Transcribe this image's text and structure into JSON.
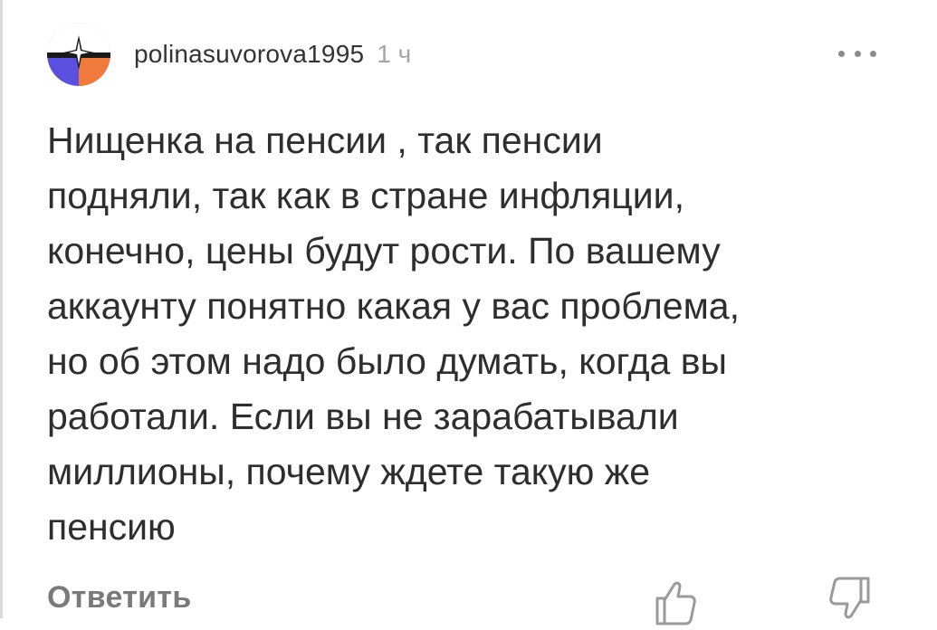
{
  "comment": {
    "username": "polinasuvorova1995",
    "time": "1 ч",
    "more_icon": "more-horizontal-icon",
    "lines": [
      "Нищенка на пенсии , так пенсии",
      "подняли, так как в стране инфляции,",
      "конечно, цены будут рости. По вашему",
      "аккаунту понятно какая у вас проблема,",
      "но об этом надо было думать, когда вы",
      "работали. Если вы не зарабатывали",
      "миллионы, почему ждете такую же",
      "пенсию"
    ]
  },
  "actions": {
    "reply_label": "Ответить",
    "like_icon": "thumbs-up-icon",
    "dislike_icon": "thumbs-down-icon"
  },
  "colors": {
    "avatar_bg": "#5b4fe0",
    "avatar_accent": "#f07a3c",
    "text": "#2e2e2e",
    "muted": "#a5a5a5"
  }
}
